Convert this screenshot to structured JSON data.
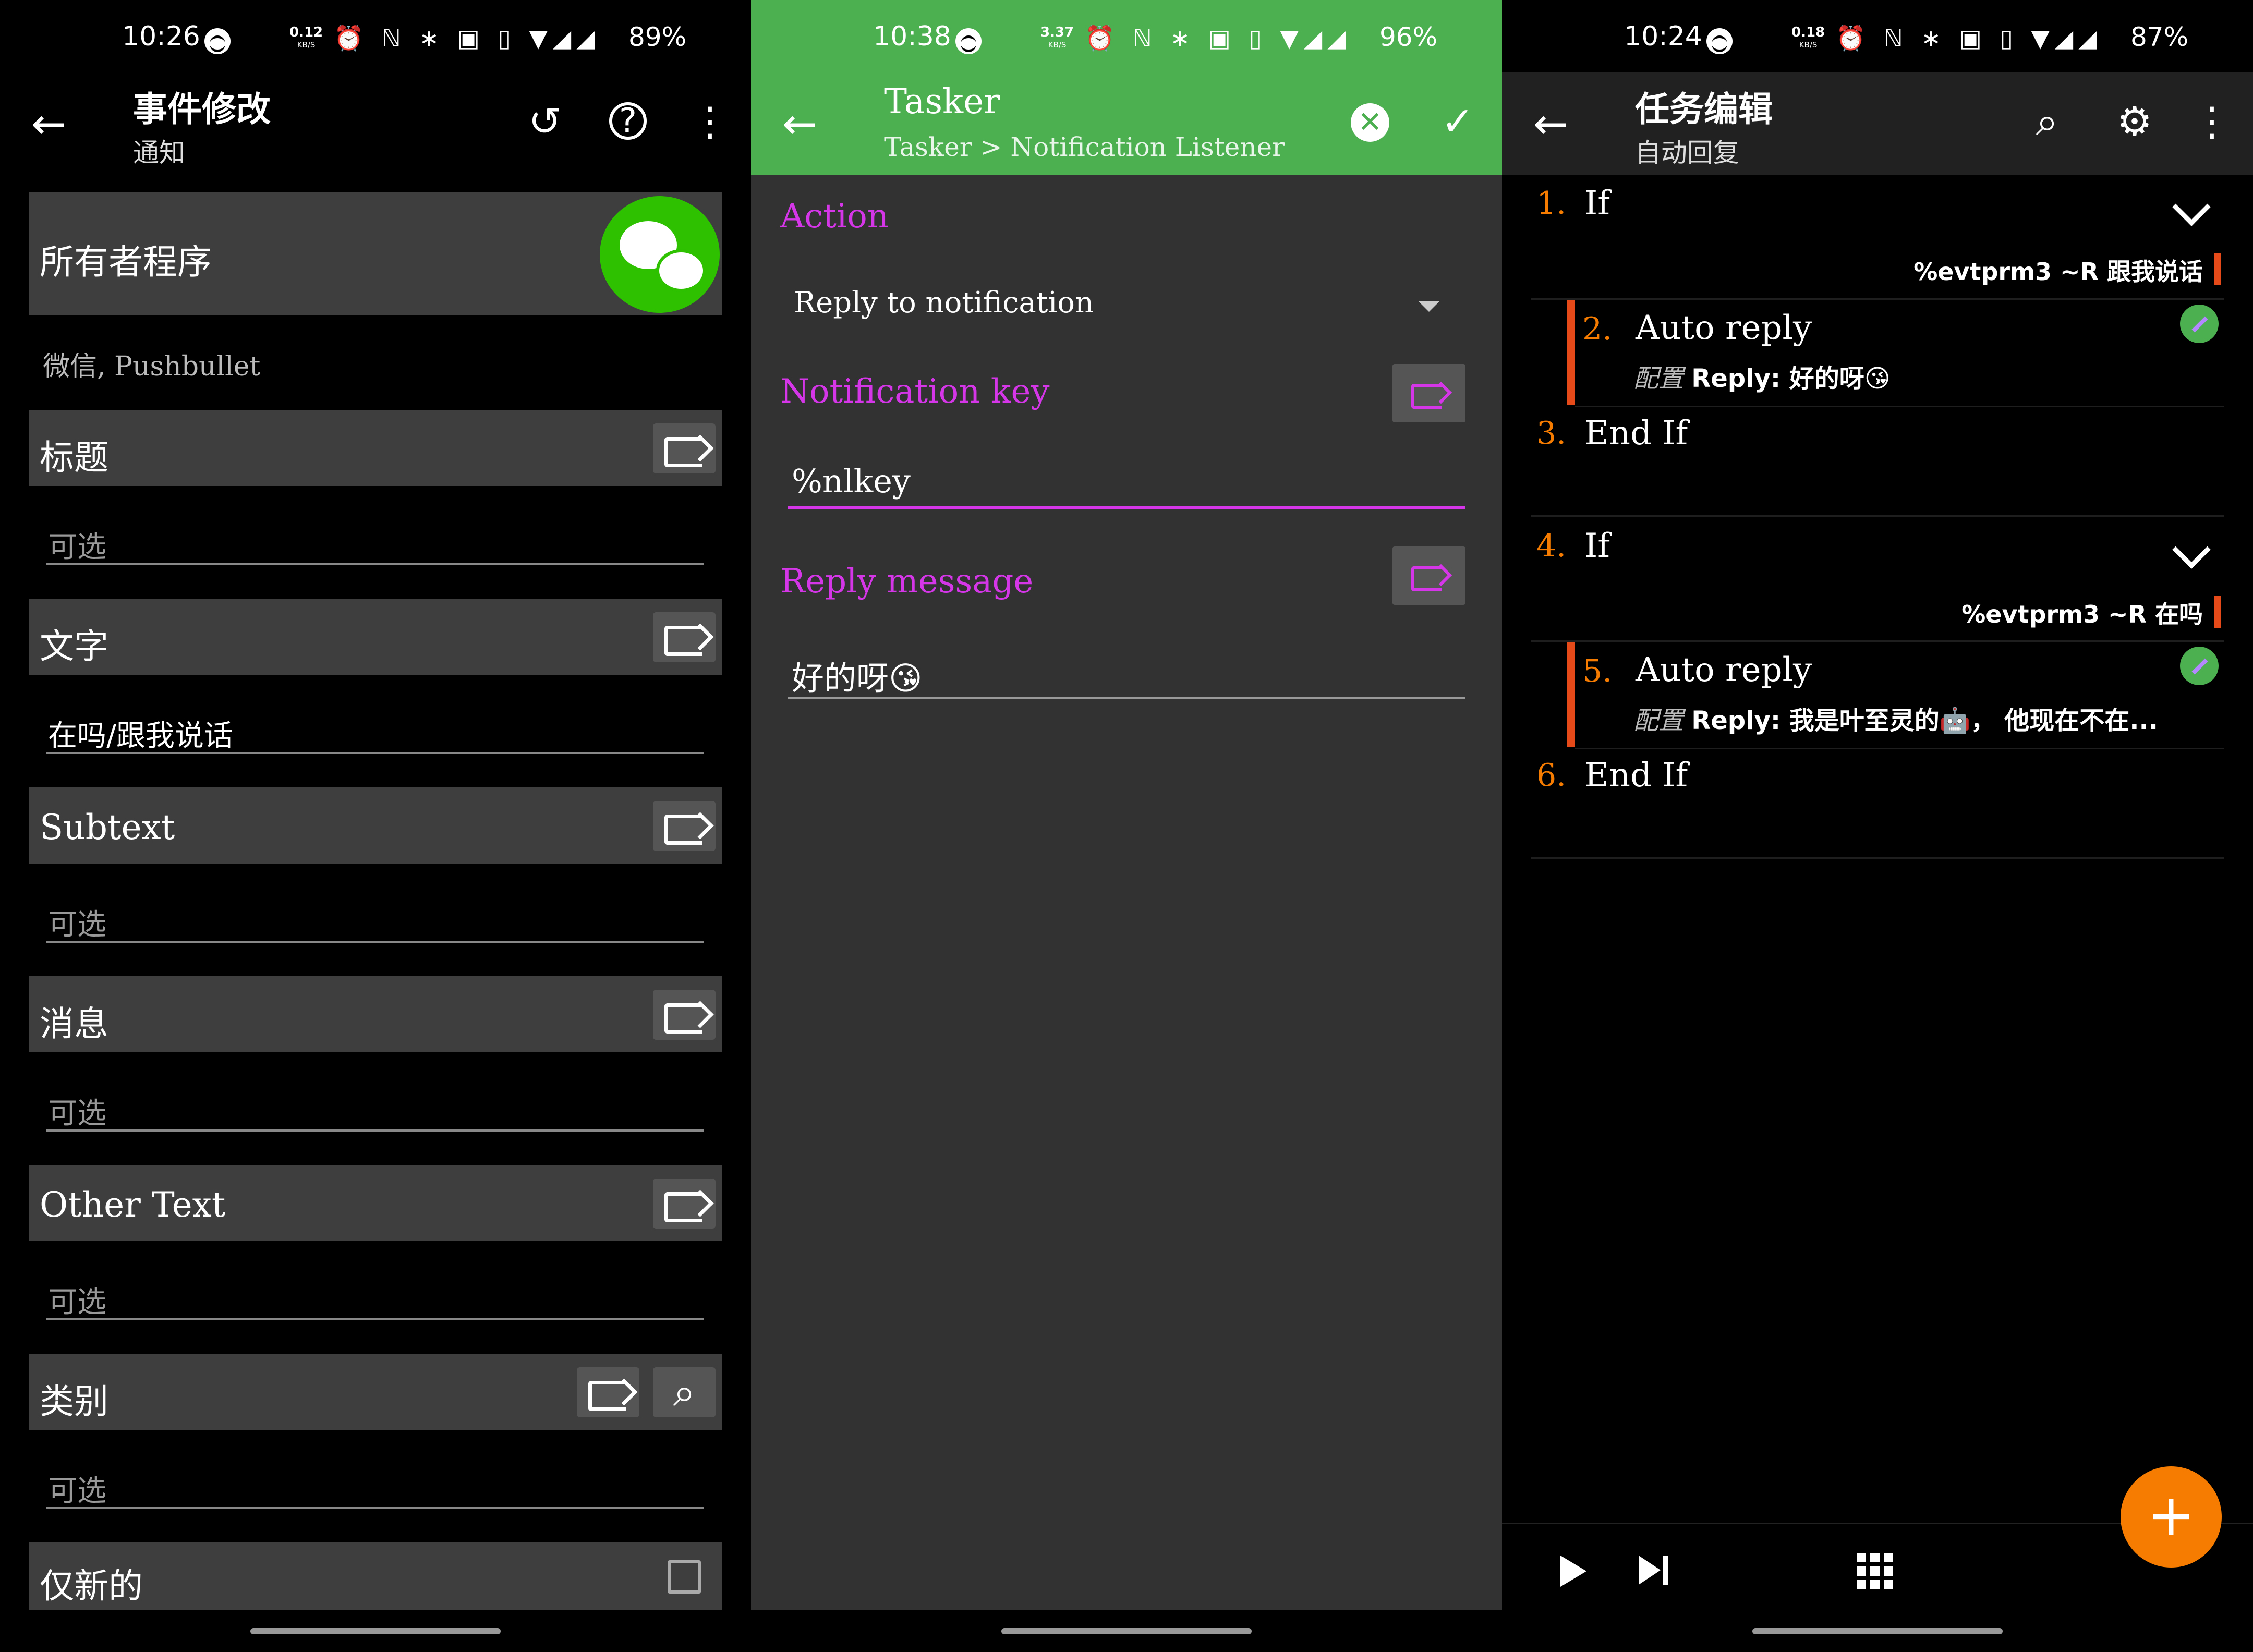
{
  "panel1": {
    "status": {
      "time": "10:26",
      "net_speed": "0.12",
      "net_unit": "KB/S",
      "battery": "89%"
    },
    "appbar": {
      "title": "事件修改",
      "subtitle": "通知"
    },
    "owner": {
      "label": "所有者程序",
      "value": "微信, Pushbullet"
    },
    "fields": [
      {
        "label": "标题",
        "value": "可选",
        "placeholder": true
      },
      {
        "label": "文字",
        "value": "在吗/跟我说话",
        "placeholder": false
      },
      {
        "label": "Subtext",
        "value": "可选",
        "placeholder": true
      },
      {
        "label": "消息",
        "value": "可选",
        "placeholder": true
      },
      {
        "label": "Other Text",
        "value": "可选",
        "placeholder": true
      },
      {
        "label": "类别",
        "value": "可选",
        "placeholder": true
      }
    ],
    "new_only": {
      "label": "仅新的",
      "checked": false
    }
  },
  "panel2": {
    "status": {
      "time": "10:38",
      "net_speed": "3.37",
      "net_unit": "KB/S",
      "battery": "96%"
    },
    "appbar": {
      "title": "Tasker",
      "subtitle": "Tasker > Notification Listener",
      "accent": "#4caf50"
    },
    "action": {
      "label": "Action",
      "value": "Reply to notification"
    },
    "notification_key": {
      "label": "Notification key",
      "value": "%nlkey"
    },
    "reply_message": {
      "label": "Reply message",
      "value": "好的呀😘"
    },
    "accent": "#d436e8"
  },
  "panel3": {
    "status": {
      "time": "10:24",
      "net_speed": "0.18",
      "net_unit": "KB/S",
      "battery": "87%"
    },
    "appbar": {
      "title": "任务编辑",
      "subtitle": "自动回复"
    },
    "steps": [
      {
        "num": "1.",
        "name": "If",
        "condition": "%evtprm3 ~R 跟我说话"
      },
      {
        "num": "2.",
        "name": "Auto reply",
        "config_label": "配置",
        "detail": "Reply: 好的呀😘"
      },
      {
        "num": "3.",
        "name": "End If"
      },
      {
        "num": "4.",
        "name": "If",
        "condition": "%evtprm3 ~R 在吗"
      },
      {
        "num": "5.",
        "name": "Auto reply",
        "config_label": "配置",
        "detail": "Reply: 我是叶至灵的🤖， 他现在不在..."
      },
      {
        "num": "6.",
        "name": "End If"
      }
    ],
    "fab": "+",
    "accent": "#f57c00"
  }
}
